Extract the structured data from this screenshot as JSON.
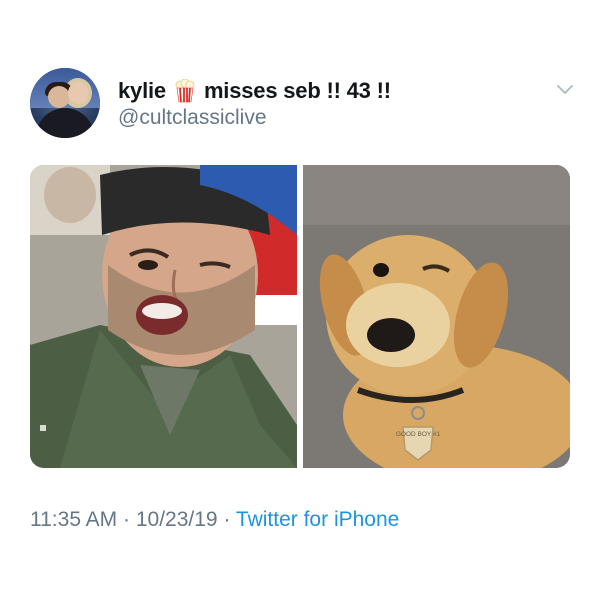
{
  "tweet": {
    "display_name": "kylie",
    "display_name_suffix": "misses seb !! 43 !!",
    "handle": "@cultclassiclive",
    "avatar_icon": "profile-avatar",
    "name_emoji_icon": "popcorn-icon",
    "menu_icon": "chevron-down-icon",
    "time": "11:35 AM",
    "separator": "·",
    "date": "10/23/19",
    "source": "Twitter for iPhone",
    "colors": {
      "text": "#14171a",
      "muted": "#657786",
      "link": "#1b95e0"
    }
  },
  "media": {
    "left_photo": "man-winking-photo",
    "right_photo": "puppy-winking-photo",
    "dog_tag_text": "GOOD BOY #1"
  }
}
